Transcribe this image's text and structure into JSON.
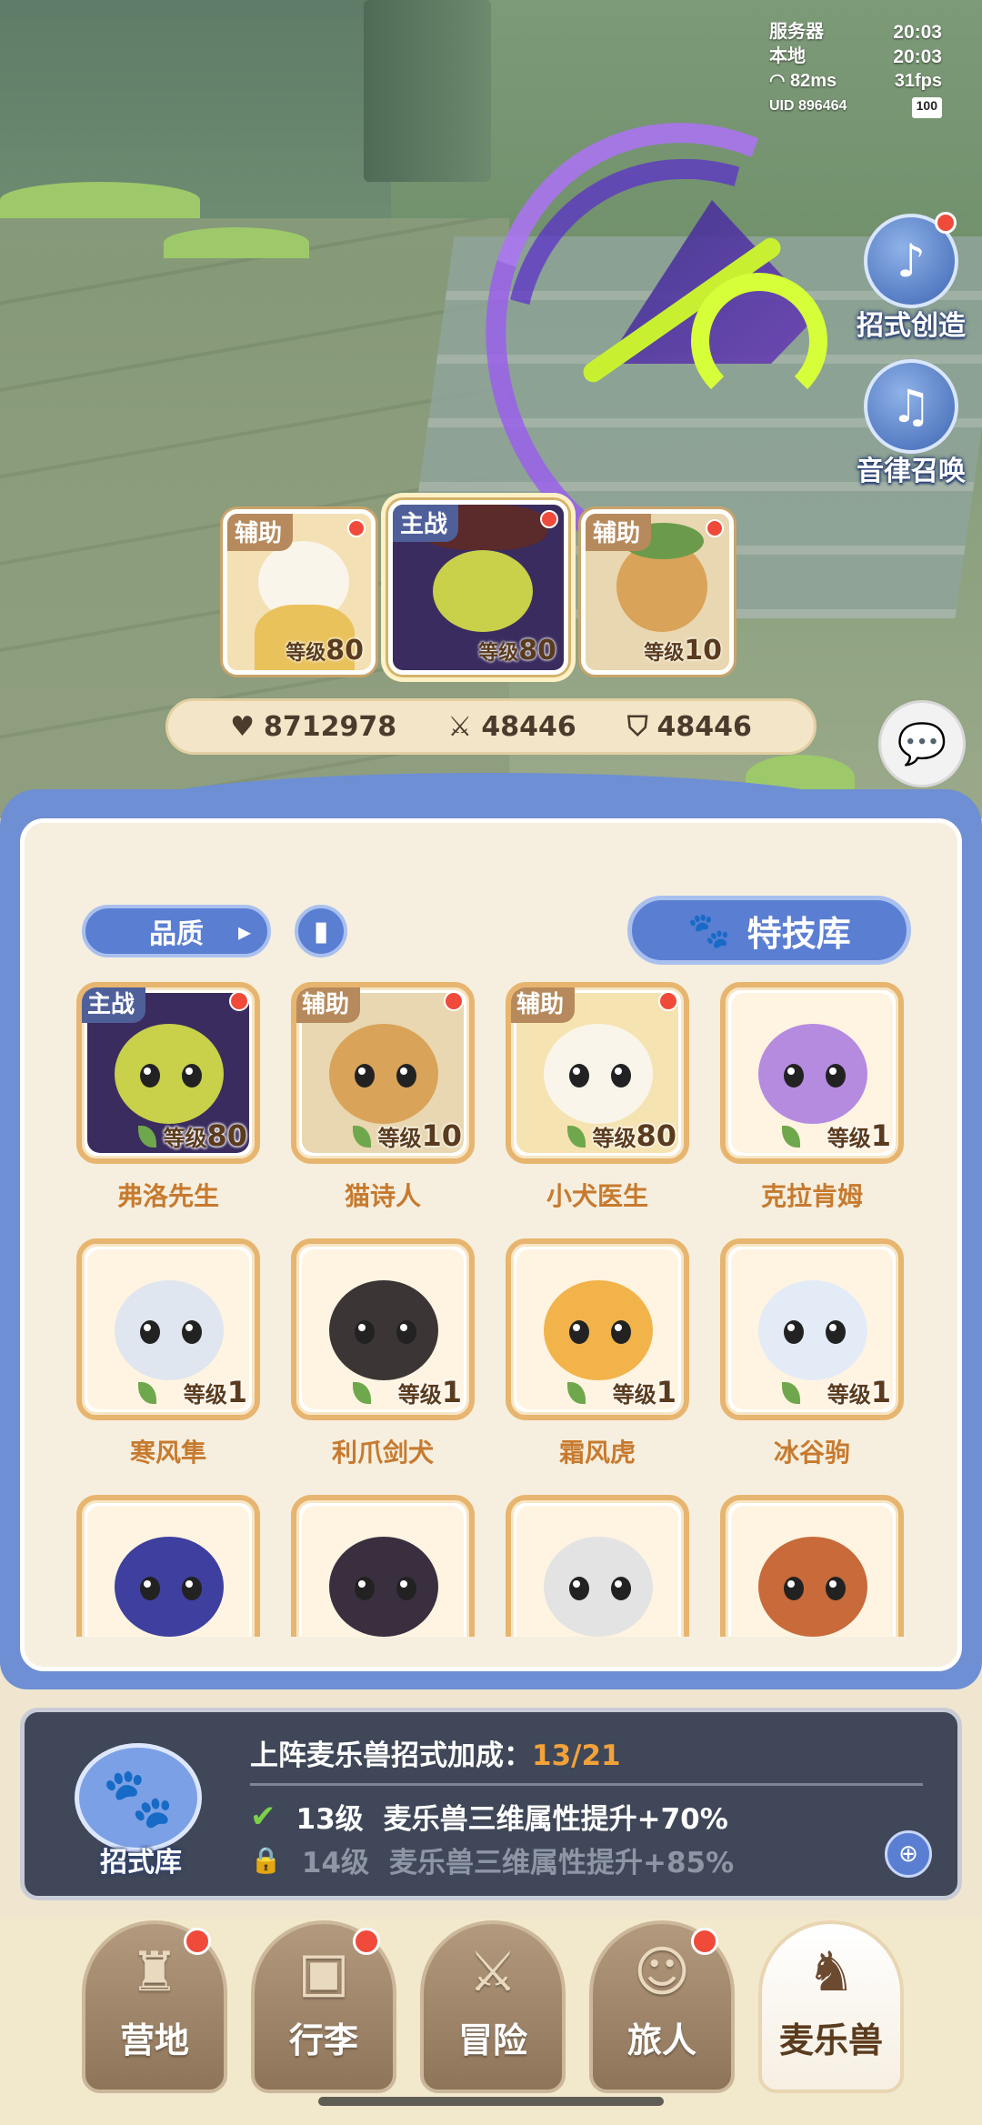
{
  "hud": {
    "server_label": "服务器",
    "server_time": "20:03",
    "local_label": "本地",
    "local_time": "20:03",
    "ping": "82ms",
    "fps": "31fps",
    "uid": "UID 896464",
    "battery": "100"
  },
  "side_buttons": [
    {
      "label": "招式创造",
      "icon": "skill-create-icon"
    },
    {
      "label": "音律召唤",
      "icon": "lyre-icon"
    }
  ],
  "team": [
    {
      "tag": "辅助",
      "level_prefix": "等级",
      "level": "80",
      "color": "#f3e0b5"
    },
    {
      "tag": "主战",
      "level_prefix": "等级",
      "level": "80",
      "color": "#3a2c5e"
    },
    {
      "tag": "辅助",
      "level_prefix": "等级",
      "level": "10",
      "color": "#d9a35a"
    }
  ],
  "stats": {
    "hp": "8712978",
    "atk": "48446",
    "def": "48446"
  },
  "filters": {
    "quality": "品质",
    "skill_library": "特技库"
  },
  "pets": [
    {
      "name": "弗洛先生",
      "tag": "主战",
      "level_prefix": "等级",
      "level": "80",
      "bg": "#3a2c5e",
      "body": "#c9d04a",
      "dot": true
    },
    {
      "name": "猫诗人",
      "tag": "辅助",
      "level_prefix": "等级",
      "level": "10",
      "bg": "#e8d7b0",
      "body": "#d9a35a",
      "dot": true
    },
    {
      "name": "小犬医生",
      "tag": "辅助",
      "level_prefix": "等级",
      "level": "80",
      "bg": "#f6e3b2",
      "body": "#faf5ea",
      "dot": true
    },
    {
      "name": "克拉肯姆",
      "tag": "",
      "level_prefix": "等级",
      "level": "1",
      "bg": "#fff4e2",
      "body": "#b58be0",
      "dot": false
    },
    {
      "name": "寒风隼",
      "tag": "",
      "level_prefix": "等级",
      "level": "1",
      "bg": "#fff4e2",
      "body": "#dfe6ef",
      "dot": false
    },
    {
      "name": "利爪剑犬",
      "tag": "",
      "level_prefix": "等级",
      "level": "1",
      "bg": "#fff4e2",
      "body": "#3b3535",
      "dot": false
    },
    {
      "name": "霜风虎",
      "tag": "",
      "level_prefix": "等级",
      "level": "1",
      "bg": "#fff4e2",
      "body": "#f2b34a",
      "dot": false
    },
    {
      "name": "冰谷驹",
      "tag": "",
      "level_prefix": "等级",
      "level": "1",
      "bg": "#fff4e2",
      "body": "#e3ecf6",
      "dot": false
    },
    {
      "name": "",
      "tag": "",
      "level_prefix": "",
      "level": "",
      "bg": "#fff4e2",
      "body": "#3e3f9e",
      "dot": false
    },
    {
      "name": "",
      "tag": "",
      "level_prefix": "",
      "level": "",
      "bg": "#fff4e2",
      "body": "#3a2f3f",
      "dot": false
    },
    {
      "name": "",
      "tag": "",
      "level_prefix": "",
      "level": "",
      "bg": "#fff4e2",
      "body": "#e3e3e3",
      "dot": false
    },
    {
      "name": "",
      "tag": "",
      "level_prefix": "",
      "level": "",
      "bg": "#fff4e2",
      "body": "#c86a3a",
      "dot": false
    }
  ],
  "bonus": {
    "library_label": "招式库",
    "title": "上阵麦乐兽招式加成：",
    "count": "13/21",
    "tiers": [
      {
        "level": "13级",
        "desc": "麦乐兽三维属性提升+70%",
        "unlocked": true
      },
      {
        "level": "14级",
        "desc": "麦乐兽三维属性提升+85%",
        "unlocked": false
      }
    ]
  },
  "nav": [
    {
      "label": "营地",
      "icon": "castle-icon",
      "dot": true,
      "active": false
    },
    {
      "label": "行李",
      "icon": "backpack-icon",
      "dot": true,
      "active": false
    },
    {
      "label": "冒险",
      "icon": "crossed-swords-icon",
      "dot": false,
      "active": false
    },
    {
      "label": "旅人",
      "icon": "traveler-icon",
      "dot": true,
      "active": false
    },
    {
      "label": "麦乐兽",
      "icon": "cat-icon",
      "dot": false,
      "active": true
    }
  ],
  "colors": {
    "accent_blue": "#5a7ed2",
    "red_dot": "#ef4a3a",
    "bonus_count": "#f3a23a",
    "pet_name": "#c77a2e"
  }
}
